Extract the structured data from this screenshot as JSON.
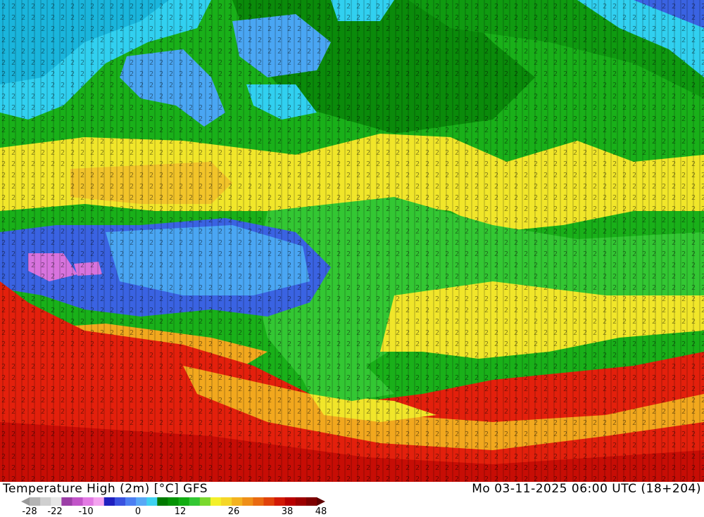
{
  "title": {
    "left": "Temperature High (2m) [°C] GFS",
    "right": "Mo 03-11-2025 06:00 UTC (18+204)"
  },
  "colorbar": {
    "ticks": [
      "-28",
      "-22",
      "-10",
      "0",
      "12",
      "26",
      "38",
      "48"
    ],
    "colors": [
      "#9a9a9a",
      "#b4b4b4",
      "#cfcfcf",
      "#e6e6e6",
      "#9b3fa6",
      "#c154c8",
      "#e27ae3",
      "#f3a3ef",
      "#1f1fbf",
      "#3a52e0",
      "#4c7ff2",
      "#58a8f6",
      "#3fd2f0",
      "#007a00",
      "#049304",
      "#12ad12",
      "#33c733",
      "#7ad92d",
      "#f3f02a",
      "#f5d628",
      "#f3b21f",
      "#ef8f18",
      "#e96a11",
      "#e0420b",
      "#d21a06",
      "#b80000",
      "#9c0000",
      "#7e0000",
      "#5f0000"
    ]
  },
  "map": {
    "palette": {
      "deep_green": "#0a8a0a",
      "green": "#19b019",
      "light_green": "#44cc38",
      "yellow": "#f1e62a",
      "orange": "#f2a81e",
      "red": "#e3200c",
      "cyan": "#31d0f0",
      "light_blue": "#4aa6f3",
      "blue": "#3a63e2",
      "magenta": "#d873de"
    }
  }
}
